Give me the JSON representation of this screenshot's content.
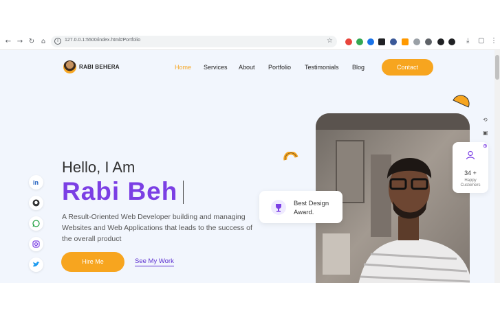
{
  "browser": {
    "url": "127.0.0.1:5500/index.html#Portfolio",
    "icons": [
      "back-icon",
      "forward-icon",
      "reload-icon",
      "home-icon",
      "info-icon",
      "star-icon",
      "download-icon",
      "extensions-icon",
      "menu-icon"
    ],
    "extension_colors": [
      "#e8453c",
      "#34a853",
      "#1a73e8",
      "#202124",
      "#3b5998",
      "#ff9900",
      "#9aa0a6",
      "#5f6368",
      "#202124",
      "#202124"
    ]
  },
  "site": {
    "brand": "RABI BEHERA",
    "nav": [
      {
        "label": "Home"
      },
      {
        "label": "Services"
      },
      {
        "label": "About"
      },
      {
        "label": "Portfolio"
      },
      {
        "label": "Testimonials"
      },
      {
        "label": "Blog"
      }
    ],
    "contact_label": "Contact",
    "accent": "#f7a51f",
    "brand_purple": "#7b3fe4"
  },
  "hero": {
    "greeting": "Hello, I Am",
    "typed_name": "Rabi Beh",
    "description": "A Result-Oriented Web Developer building and managing Websites and Web Applications that leads to the success of the overall product",
    "hire_label": "Hire Me",
    "work_label": "See My Work"
  },
  "social": [
    "linkedin-icon",
    "github-icon",
    "whatsapp-icon",
    "instagram-icon",
    "twitter-icon"
  ],
  "award": {
    "line1": "Best Design",
    "line2": "Award."
  },
  "happy": {
    "count": "34 +",
    "label_line1": "Happy",
    "label_line2": "Customers"
  }
}
